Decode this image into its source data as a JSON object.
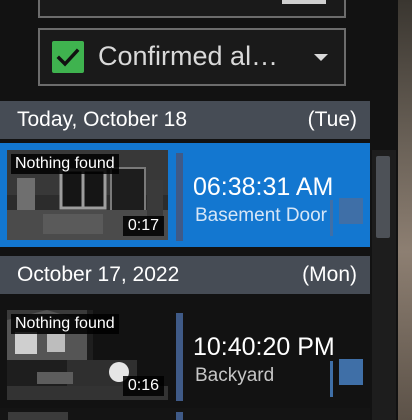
{
  "filter": {
    "label": "Confirmed al…",
    "checked": true,
    "check_color": "#3fb34f"
  },
  "sections": [
    {
      "date": "Today, October 18",
      "day_of_week": "(Tue)",
      "events": [
        {
          "status": "Nothing found",
          "duration": "0:17",
          "time": "06:38:31 AM",
          "camera": "Basement Door",
          "selected": true
        }
      ]
    },
    {
      "date": "October 17, 2022",
      "day_of_week": "(Mon)",
      "events": [
        {
          "status": "Nothing found",
          "duration": "0:16",
          "time": "10:40:20 PM",
          "camera": "Backyard",
          "selected": false
        }
      ]
    }
  ],
  "colors": {
    "selected_row": "#1377d0",
    "section_header": "#464c55",
    "flag": "#3f6fa7",
    "camera_text_selected": "#d6e6f7",
    "camera_text": "#c6c6c6"
  },
  "icons": {
    "filter_check": "checkmark-icon",
    "filter_caret": "chevron-down-icon",
    "event_flag": "flag-icon"
  }
}
